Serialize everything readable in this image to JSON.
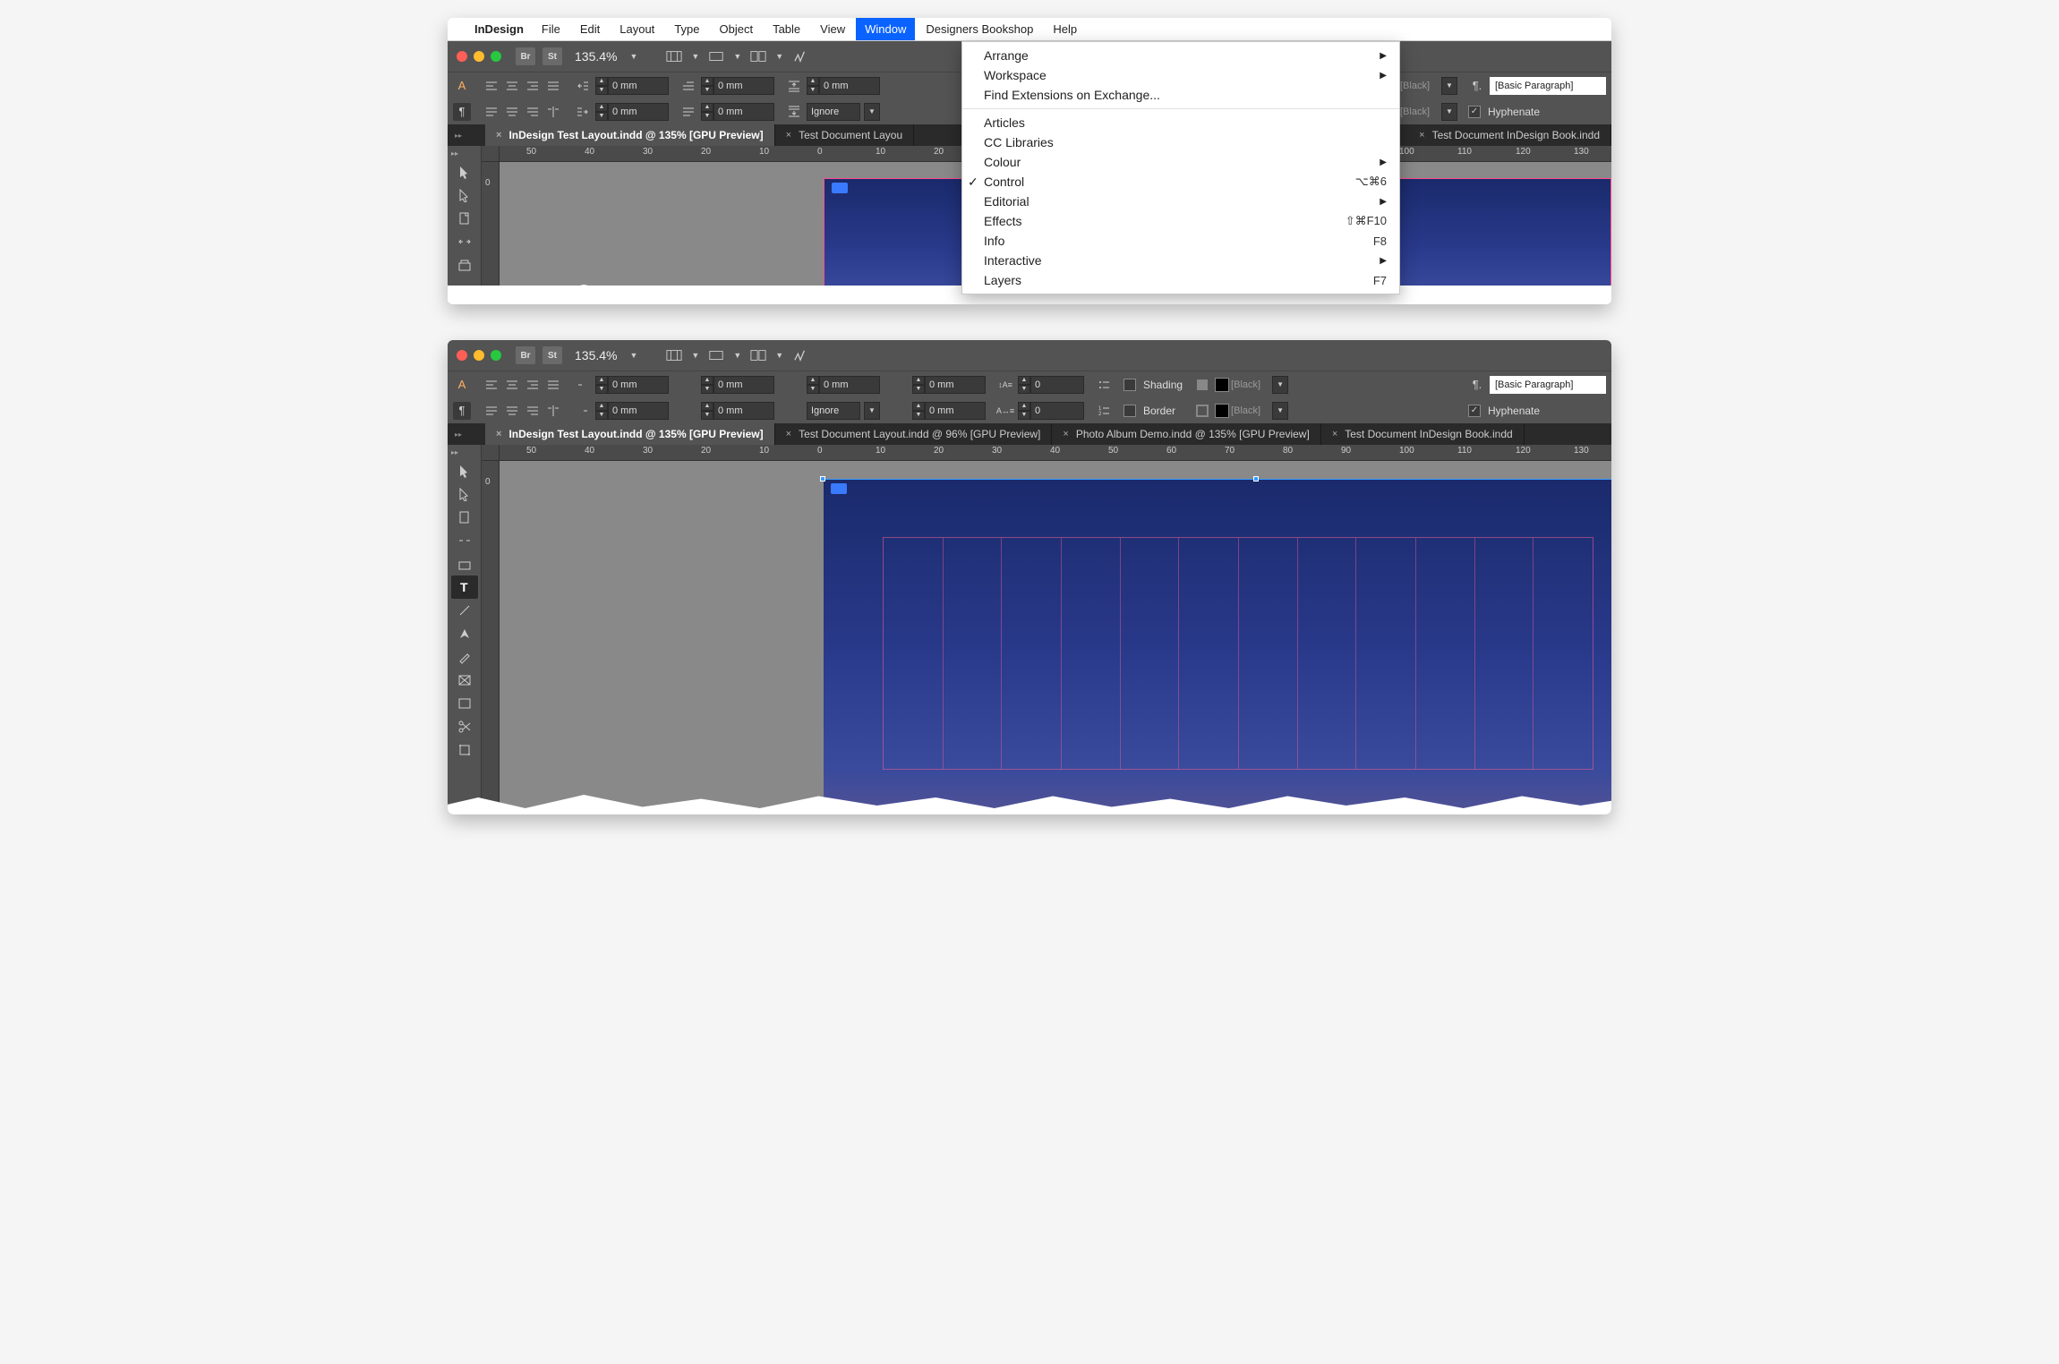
{
  "menubar": {
    "app": "InDesign",
    "items": [
      "File",
      "Edit",
      "Layout",
      "Type",
      "Object",
      "Table",
      "View",
      "Window",
      "Designers Bookshop",
      "Help"
    ],
    "active": "Window"
  },
  "dropdown": {
    "groups": [
      [
        {
          "label": "Arrange",
          "sub": true
        },
        {
          "label": "Workspace",
          "sub": true
        },
        {
          "label": "Find Extensions on Exchange..."
        }
      ],
      [
        {
          "label": "Articles"
        },
        {
          "label": "CC Libraries"
        },
        {
          "label": "Colour",
          "sub": true
        },
        {
          "label": "Control",
          "checked": true,
          "shortcut": "⌥⌘6"
        },
        {
          "label": "Editorial",
          "sub": true
        },
        {
          "label": "Effects",
          "shortcut": "⇧⌘F10"
        },
        {
          "label": "Info",
          "shortcut": "F8"
        },
        {
          "label": "Interactive",
          "sub": true
        },
        {
          "label": "Layers",
          "shortcut": "F7"
        }
      ]
    ]
  },
  "appbar": {
    "br": "Br",
    "st": "St",
    "zoom": "135.4%"
  },
  "control": {
    "indent_left": "0 mm",
    "indent_right": "0 mm",
    "first_line": "0 mm",
    "last_line": "0 mm",
    "space_before": "0 mm",
    "space_after": "0 mm",
    "same_style": "0 mm",
    "align_to": "Ignore",
    "drop_lines": "0",
    "drop_chars": "0",
    "shading": "Shading",
    "border": "Border",
    "swatch1": "[Black]",
    "swatch2": "[Black]",
    "pstyle": "[Basic Paragraph]",
    "hyphenate": "Hyphenate"
  },
  "tabs_top": [
    {
      "label": "InDesign Test Layout.indd @ 135% [GPU Preview]",
      "active": true
    },
    {
      "label": "Test Document Layou"
    },
    {
      "label": "Test Document InDesign Book.indd"
    }
  ],
  "tabs_bottom": [
    {
      "label": "InDesign Test Layout.indd @ 135% [GPU Preview]",
      "active": true
    },
    {
      "label": "Test Document Layout.indd @ 96% [GPU Preview]"
    },
    {
      "label": "Photo Album Demo.indd @ 135% [GPU Preview]"
    },
    {
      "label": "Test Document InDesign Book.indd"
    }
  ],
  "ruler": {
    "h1": [
      "50",
      "40",
      "30",
      "20",
      "10",
      "0",
      "10",
      "20",
      "30",
      "40",
      "50",
      "60",
      "70",
      "80",
      "90",
      "100",
      "110",
      "120",
      "130"
    ],
    "v1": [
      "0"
    ]
  }
}
